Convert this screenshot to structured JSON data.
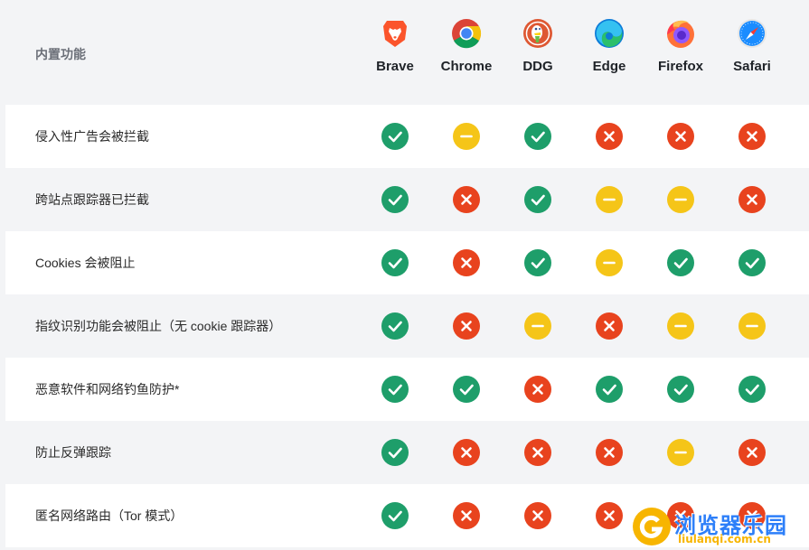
{
  "header": {
    "feature_title": "内置功能",
    "browsers": [
      {
        "name": "Brave",
        "icon": "brave-lion-icon",
        "color": "#fb542b"
      },
      {
        "name": "Chrome",
        "icon": "chrome-icon",
        "color": "#4285f4"
      },
      {
        "name": "DDG",
        "icon": "duckduckgo-icon",
        "color": "#de5833"
      },
      {
        "name": "Edge",
        "icon": "edge-icon",
        "color": "#0c7bd8"
      },
      {
        "name": "Firefox",
        "icon": "firefox-icon",
        "color": "#ff7139"
      },
      {
        "name": "Safari",
        "icon": "safari-compass-icon",
        "color": "#1a8cff"
      }
    ]
  },
  "status_colors": {
    "yes": "#1e9e6a",
    "no": "#e8431e",
    "partial": "#f5c518"
  },
  "rows": [
    {
      "label": "侵入性广告会被拦截",
      "status": [
        "yes",
        "partial",
        "yes",
        "no",
        "no",
        "no"
      ]
    },
    {
      "label": "跨站点跟踪器已拦截",
      "status": [
        "yes",
        "no",
        "yes",
        "partial",
        "partial",
        "no"
      ]
    },
    {
      "label": "Cookies 会被阻止",
      "status": [
        "yes",
        "no",
        "yes",
        "partial",
        "yes",
        "yes"
      ]
    },
    {
      "label": "指纹识别功能会被阻止（无 cookie 跟踪器）",
      "status": [
        "yes",
        "no",
        "partial",
        "no",
        "partial",
        "partial"
      ]
    },
    {
      "label": "恶意软件和网络钓鱼防护*",
      "status": [
        "yes",
        "yes",
        "no",
        "yes",
        "yes",
        "yes"
      ]
    },
    {
      "label": "防止反弹跟踪",
      "status": [
        "yes",
        "no",
        "no",
        "no",
        "partial",
        "no"
      ]
    },
    {
      "label": "匿名网络路由（Tor 模式）",
      "status": [
        "yes",
        "no",
        "no",
        "no",
        "no",
        "no"
      ]
    }
  ],
  "watermark": {
    "title": "浏览器乐园",
    "subtitle": "liulanqi.com.cn"
  }
}
